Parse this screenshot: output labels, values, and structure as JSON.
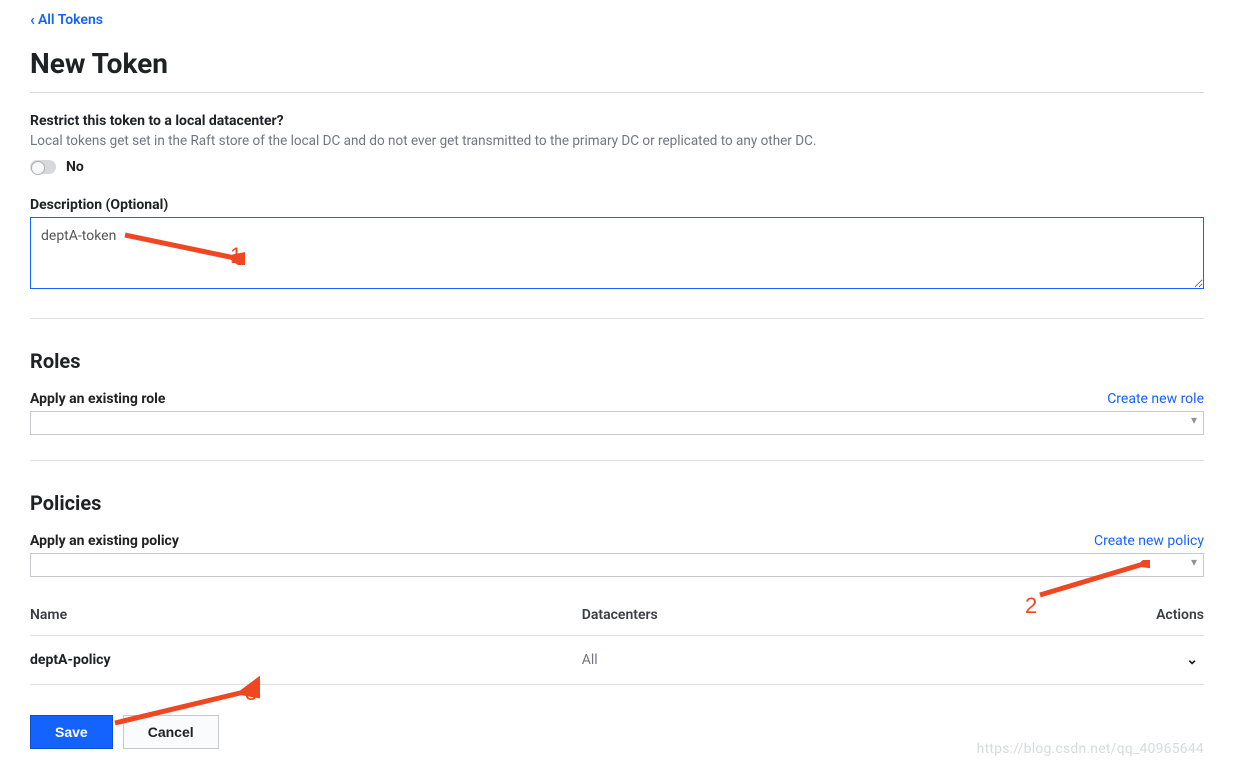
{
  "back_link": "All Tokens",
  "page_title": "New Token",
  "restrict": {
    "label": "Restrict this token to a local datacenter?",
    "hint": "Local tokens get set in the Raft store of the local DC and do not ever get transmitted to the primary DC or replicated to any other DC.",
    "toggle_value": "No"
  },
  "description": {
    "label": "Description (Optional)",
    "value": "deptA-token"
  },
  "roles": {
    "title": "Roles",
    "apply_label": "Apply an existing role",
    "create_link": "Create new role"
  },
  "policies": {
    "title": "Policies",
    "apply_label": "Apply an existing policy",
    "create_link": "Create new policy",
    "columns": {
      "name": "Name",
      "datacenters": "Datacenters",
      "actions": "Actions"
    },
    "rows": [
      {
        "name": "deptA-policy",
        "datacenters": "All"
      }
    ]
  },
  "buttons": {
    "save": "Save",
    "cancel": "Cancel"
  },
  "annotations": {
    "a1": "1",
    "a2": "2",
    "a3": "3"
  },
  "watermark": "https://blog.csdn.net/qq_40965644"
}
